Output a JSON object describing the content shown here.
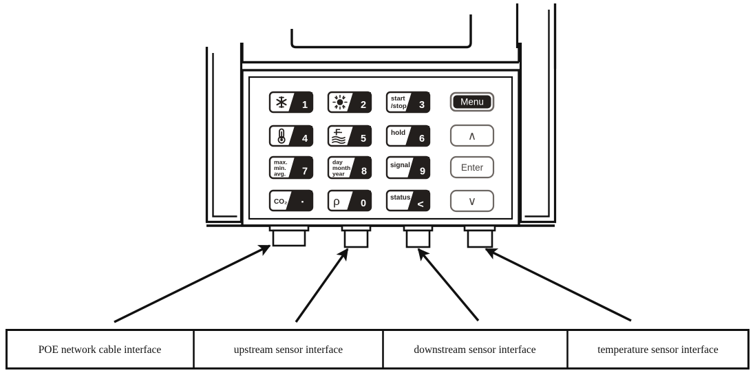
{
  "figure": {
    "kind": "technical-line-drawing",
    "subject": "measuring-instrument-keypad-and-connector-panel"
  },
  "keypad": {
    "keys": [
      {
        "id": "key-snowflake-1",
        "icon": "snowflake-icon",
        "label": "",
        "number": "1",
        "style": "split"
      },
      {
        "id": "key-sun-2",
        "icon": "sun-icon",
        "label": "",
        "number": "2",
        "style": "split"
      },
      {
        "id": "key-start-stop-3",
        "icon": "",
        "label": "start\n/stop",
        "number": "3",
        "style": "split"
      },
      {
        "id": "key-menu",
        "icon": "",
        "label": "Menu",
        "number": "",
        "style": "filled"
      },
      {
        "id": "key-thermometer-4",
        "icon": "thermometer-icon",
        "label": "",
        "number": "4",
        "style": "split"
      },
      {
        "id": "key-flow-5",
        "icon": "flow-waves-icon",
        "label": "",
        "number": "5",
        "style": "split"
      },
      {
        "id": "key-hold-6",
        "icon": "",
        "label": "hold",
        "number": "6",
        "style": "split"
      },
      {
        "id": "key-up",
        "icon": "chevron-up-icon",
        "label": "∧",
        "number": "",
        "style": "outline"
      },
      {
        "id": "key-maxminavg-7",
        "icon": "",
        "label": "max.\nmin.\navg.",
        "number": "7",
        "style": "split"
      },
      {
        "id": "key-daymonthyear-8",
        "icon": "",
        "label": "day\nmonth\nyear",
        "number": "8",
        "style": "split"
      },
      {
        "id": "key-signal-9",
        "icon": "",
        "label": "signal",
        "number": "9",
        "style": "split"
      },
      {
        "id": "key-enter",
        "icon": "",
        "label": "Enter",
        "number": "",
        "style": "outline"
      },
      {
        "id": "key-co2-dot",
        "icon": "",
        "label": "CO₂",
        "number": "·",
        "style": "split"
      },
      {
        "id": "key-rho-0",
        "icon": "",
        "label": "ρ",
        "number": "0",
        "style": "split"
      },
      {
        "id": "key-status-back",
        "icon": "",
        "label": "status",
        "number": "<",
        "style": "split"
      },
      {
        "id": "key-down",
        "icon": "chevron-down-icon",
        "label": "∨",
        "number": "",
        "style": "outline"
      }
    ],
    "key_labels": {
      "start_stop_line1": "start",
      "start_stop_line2": "/stop",
      "menu": "Menu",
      "hold": "hold",
      "up": "∧",
      "maxminavg_line1": "max.",
      "maxminavg_line2": "min.",
      "maxminavg_line3": "avg.",
      "daymonthyear_line1": "day",
      "daymonthyear_line2": "month",
      "daymonthyear_line3": "year",
      "signal": "signal",
      "enter": "Enter",
      "co2": "CO₂",
      "rho": "ρ",
      "status": "status",
      "down": "∨"
    },
    "key_numbers": {
      "n1": "1",
      "n2": "2",
      "n3": "3",
      "n4": "4",
      "n5": "5",
      "n6": "6",
      "n7": "7",
      "n8": "8",
      "n9": "9",
      "dot": "·",
      "n0": "0",
      "back": "<"
    }
  },
  "connectors": [
    {
      "id": "connector-poe",
      "callout": "POE network cable interface"
    },
    {
      "id": "connector-upstream",
      "callout": "upstream sensor interface"
    },
    {
      "id": "connector-downstream",
      "callout": "downstream sensor interface"
    },
    {
      "id": "connector-temperature",
      "callout": "temperature sensor interface"
    }
  ],
  "callout_table": {
    "columns": 4,
    "cells": [
      "POE network cable interface",
      "upstream sensor interface",
      "downstream sensor interface",
      "temperature sensor interface"
    ]
  },
  "colors": {
    "line": "#111111",
    "fill_dark": "#231f1d",
    "background": "#ffffff",
    "text": "#111111"
  }
}
